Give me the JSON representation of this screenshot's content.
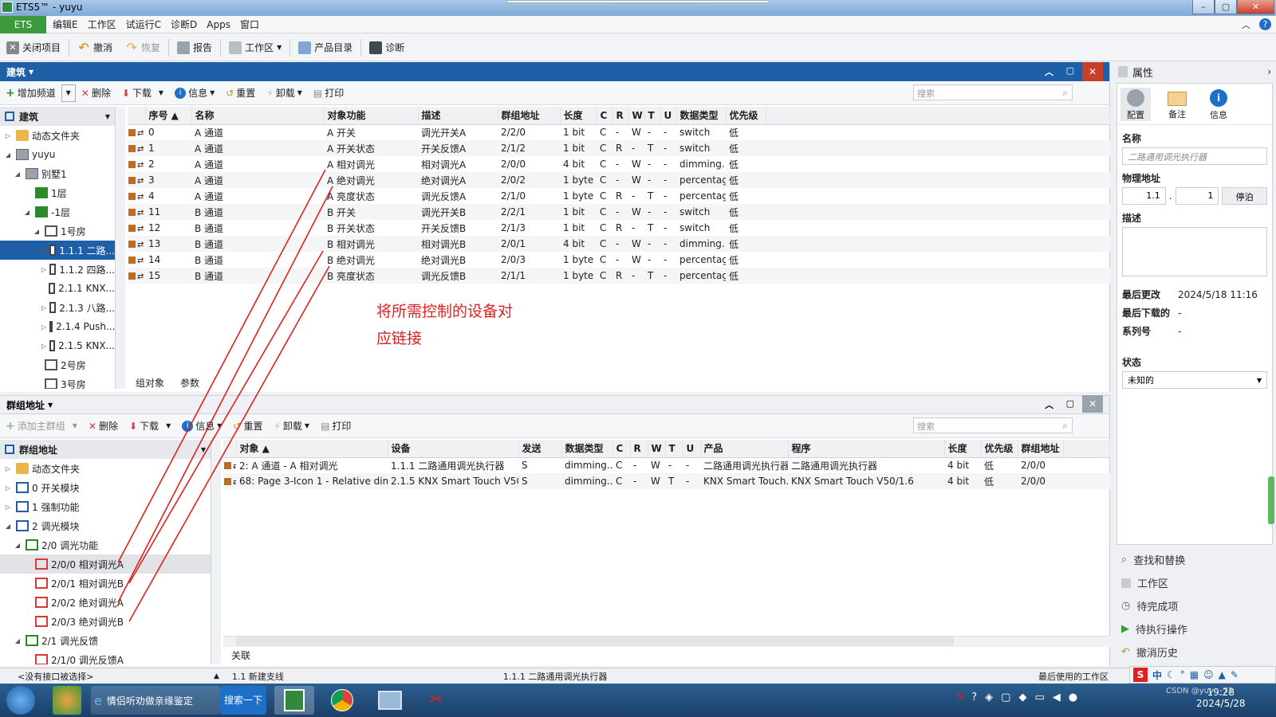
{
  "window": {
    "title": "ETS5™ - yuyu"
  },
  "menu": {
    "ets": "ETS",
    "items": [
      "编辑E",
      "工作区",
      "试运行C",
      "诊断D",
      "Apps",
      "窗口"
    ]
  },
  "toolbar": {
    "close_project": "关闭项目",
    "undo": "撤消",
    "redo": "恢复",
    "report": "报告",
    "workspace": "工作区",
    "catalog": "产品目录",
    "diagnostics": "诊断"
  },
  "building_panel": {
    "title": "建筑",
    "tools": {
      "add_channel": "增加频道",
      "delete": "删除",
      "download": "下载",
      "info": "信息",
      "reset": "重置",
      "unload": "卸载",
      "print": "打印",
      "search": "搜索"
    },
    "tree_header": "建筑",
    "tree": [
      {
        "label": "动态文件夹",
        "indent": 0,
        "exp": "▷",
        "icon": "folder"
      },
      {
        "label": "yuyu",
        "indent": 0,
        "exp": "◢",
        "icon": "building"
      },
      {
        "label": "别墅1",
        "indent": 1,
        "exp": "◢",
        "icon": "building"
      },
      {
        "label": "1层",
        "indent": 2,
        "exp": "",
        "icon": "floor"
      },
      {
        "label": "-1层",
        "indent": 2,
        "exp": "◢",
        "icon": "floor"
      },
      {
        "label": "1号房",
        "indent": 3,
        "exp": "◢",
        "icon": "room"
      },
      {
        "label": "1.1.1 二路...",
        "indent": 4,
        "exp": "▶",
        "icon": "device",
        "sel": true
      },
      {
        "label": "1.1.2 四路...",
        "indent": 4,
        "exp": "▷",
        "icon": "device"
      },
      {
        "label": "2.1.1 KNX...",
        "indent": 4,
        "exp": "",
        "icon": "device"
      },
      {
        "label": "2.1.3 八路...",
        "indent": 4,
        "exp": "▷",
        "icon": "device"
      },
      {
        "label": "2.1.4 Push...",
        "indent": 4,
        "exp": "▷",
        "icon": "device"
      },
      {
        "label": "2.1.5 KNX...",
        "indent": 4,
        "exp": "▷",
        "icon": "device"
      },
      {
        "label": "2号房",
        "indent": 3,
        "exp": "",
        "icon": "room"
      },
      {
        "label": "3号房",
        "indent": 3,
        "exp": "",
        "icon": "room"
      }
    ],
    "columns": [
      "序号 ▲",
      "名称",
      "对象功能",
      "描述",
      "群组地址",
      "长度",
      "C",
      "R",
      "W",
      "T",
      "U",
      "数据类型",
      "优先级"
    ],
    "rows": [
      [
        "0",
        "A 通道",
        "A 开关",
        "调光开关A",
        "2/2/0",
        "1 bit",
        "C",
        "-",
        "W",
        "-",
        "-",
        "switch",
        "低"
      ],
      [
        "1",
        "A 通道",
        "A 开关状态",
        "开关反馈A",
        "2/1/2",
        "1 bit",
        "C",
        "R",
        "-",
        "T",
        "-",
        "switch",
        "低"
      ],
      [
        "2",
        "A 通道",
        "A 相对调光",
        "相对调光A",
        "2/0/0",
        "4 bit",
        "C",
        "-",
        "W",
        "-",
        "-",
        "dimming...",
        "低"
      ],
      [
        "3",
        "A 通道",
        "A 绝对调光",
        "绝对调光A",
        "2/0/2",
        "1 byte",
        "C",
        "-",
        "W",
        "-",
        "-",
        "percentag...",
        "低"
      ],
      [
        "4",
        "A 通道",
        "A 亮度状态",
        "调光反馈A",
        "2/1/0",
        "1 byte",
        "C",
        "R",
        "-",
        "T",
        "-",
        "percentag...",
        "低"
      ],
      [
        "11",
        "B 通道",
        "B 开关",
        "调光开关B",
        "2/2/1",
        "1 bit",
        "C",
        "-",
        "W",
        "-",
        "-",
        "switch",
        "低"
      ],
      [
        "12",
        "B 通道",
        "B 开关状态",
        "开关反馈B",
        "2/1/3",
        "1 bit",
        "C",
        "R",
        "-",
        "T",
        "-",
        "switch",
        "低"
      ],
      [
        "13",
        "B 通道",
        "B 相对调光",
        "相对调光B",
        "2/0/1",
        "4 bit",
        "C",
        "-",
        "W",
        "-",
        "-",
        "dimming...",
        "低"
      ],
      [
        "14",
        "B 通道",
        "B 绝对调光",
        "绝对调光B",
        "2/0/3",
        "1 byte",
        "C",
        "-",
        "W",
        "-",
        "-",
        "percentag...",
        "低"
      ],
      [
        "15",
        "B 通道",
        "B 亮度状态",
        "调光反馈B",
        "2/1/1",
        "1 byte",
        "C",
        "R",
        "-",
        "T",
        "-",
        "percentag...",
        "低"
      ]
    ],
    "annotation_line1": "将所需控制的设备对",
    "annotation_line2": "应链接",
    "tabs": [
      "组对象",
      "参数"
    ]
  },
  "group_panel": {
    "title": "群组地址",
    "tools": {
      "add_main": "添加主群组",
      "delete": "删除",
      "download": "下载",
      "info": "信息",
      "reset": "重置",
      "unload": "卸载",
      "print": "打印",
      "search": "搜索"
    },
    "tree_header": "群组地址",
    "tree": [
      {
        "label": "动态文件夹",
        "indent": 0,
        "exp": "▷",
        "icon": "folder"
      },
      {
        "label": "0 开关模块",
        "indent": 0,
        "exp": "▷",
        "icon": "blue"
      },
      {
        "label": "1 强制功能",
        "indent": 0,
        "exp": "▷",
        "icon": "blue"
      },
      {
        "label": "2 调光模块",
        "indent": 0,
        "exp": "◢",
        "icon": "blue"
      },
      {
        "label": "2/0 调光功能",
        "indent": 1,
        "exp": "◢",
        "icon": "green"
      },
      {
        "label": "2/0/0 相对调光A",
        "indent": 2,
        "exp": "",
        "icon": "red",
        "hl": true
      },
      {
        "label": "2/0/1 相对调光B",
        "indent": 2,
        "exp": "",
        "icon": "red"
      },
      {
        "label": "2/0/2 绝对调光A",
        "indent": 2,
        "exp": "",
        "icon": "red"
      },
      {
        "label": "2/0/3 绝对调光B",
        "indent": 2,
        "exp": "",
        "icon": "red"
      },
      {
        "label": "2/1 调光反馈",
        "indent": 1,
        "exp": "◢",
        "icon": "green"
      },
      {
        "label": "2/1/0 调光反馈A",
        "indent": 2,
        "exp": "",
        "icon": "red"
      }
    ],
    "columns": [
      "对象 ▲",
      "设备",
      "发送",
      "数据类型",
      "C",
      "R",
      "W",
      "T",
      "U",
      "产品",
      "程序",
      "长度",
      "优先级",
      "群组地址"
    ],
    "rows": [
      [
        "2: A 通道 - A 相对调光",
        "1.1.1 二路通用调光执行器",
        "S",
        "dimming...",
        "C",
        "-",
        "W",
        "-",
        "-",
        "二路通用调光执行器",
        "二路通用调光执行器",
        "4 bit",
        "低",
        "2/0/0"
      ],
      [
        "68: Page 3-Icon 1 - Relative dimm...",
        "2.1.5 KNX Smart Touch V50",
        "S",
        "dimming...",
        "C",
        "-",
        "W",
        "T",
        "-",
        "KNX Smart Touch...",
        "KNX Smart Touch V50/1.6",
        "4 bit",
        "低",
        "2/0/0"
      ]
    ],
    "tab": "关联"
  },
  "properties": {
    "title": "属性",
    "tabs": [
      "配置",
      "备注",
      "信息"
    ],
    "name_label": "名称",
    "name_placeholder": "二路通用调光执行器",
    "phys_label": "物理地址",
    "phys_area": "1.1",
    "phys_dot": ".",
    "phys_dev": "1",
    "park_btn": "停泊",
    "desc_label": "描述",
    "last_changed_label": "最后更改",
    "last_changed": "2024/5/18 11:16",
    "last_download_label": "最后下载的",
    "last_download": "-",
    "serial_label": "系列号",
    "serial": "-",
    "state_label": "状态",
    "state": "未知的",
    "links": [
      "查找和替换",
      "工作区",
      "待完成项",
      "待执行操作",
      "撤消历史"
    ]
  },
  "status": {
    "interface": "<没有接口被选择>",
    "line": "1.1 新建支线",
    "device": "1.1.1 二路通用调光执行器",
    "recent": "最后使用的工作区"
  },
  "taskbar": {
    "browser_title": "情侣听劝做亲缘鉴定",
    "search_btn": "搜索一下",
    "time": "19:28",
    "date": "2024/5/28",
    "ime": "中",
    "watermark": "CSDN @yuyu_72"
  },
  "colors": {
    "accent": "#1f5fa8",
    "ets_green": "#3c9a3c",
    "annotation": "#e02020"
  }
}
